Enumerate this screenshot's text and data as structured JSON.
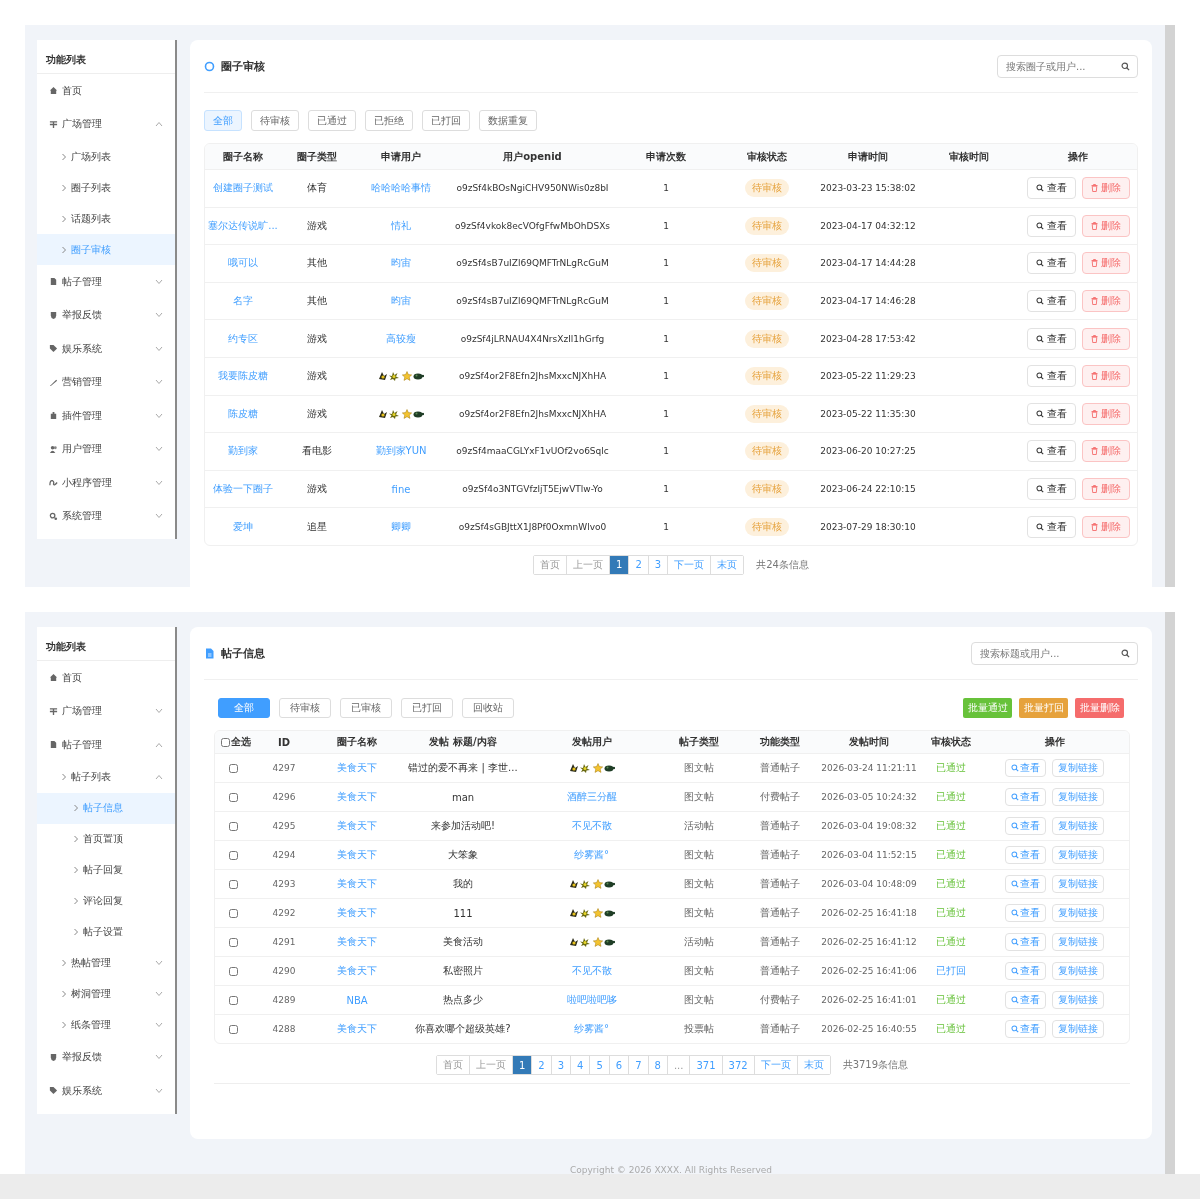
{
  "review_screen": {
    "sidebar": {
      "title": "功能列表",
      "items": [
        {
          "label": "首页",
          "selected": false
        },
        {
          "label": "广场管理",
          "selected": false,
          "expanded": true,
          "children": [
            {
              "label": "广场列表",
              "selected": false
            },
            {
              "label": "圈子列表",
              "selected": false
            },
            {
              "label": "话题列表",
              "selected": false
            },
            {
              "label": "圈子审核",
              "selected": true
            }
          ]
        },
        {
          "label": "帖子管理",
          "selected": false,
          "expanded": false
        },
        {
          "label": "举报反馈",
          "selected": false,
          "expanded": false
        },
        {
          "label": "娱乐系统",
          "selected": false,
          "expanded": false
        },
        {
          "label": "营销管理",
          "selected": false,
          "expanded": false
        },
        {
          "label": "插件管理",
          "selected": false,
          "expanded": false
        },
        {
          "label": "用户管理",
          "selected": false,
          "expanded": false
        },
        {
          "label": "小程序管理",
          "selected": false,
          "expanded": false
        },
        {
          "label": "系统管理",
          "selected": false,
          "expanded": false
        }
      ]
    },
    "title": "圈子审核",
    "search": {
      "placeholder": "搜索圈子或用户..."
    },
    "tabs": [
      {
        "label": "全部",
        "selected": true
      },
      {
        "label": "待审核",
        "selected": false
      },
      {
        "label": "已通过",
        "selected": false
      },
      {
        "label": "已拒绝",
        "selected": false
      },
      {
        "label": "已打回",
        "selected": false
      },
      {
        "label": "数据重复",
        "selected": false
      }
    ],
    "table": {
      "columns": [
        "圈子名称",
        "圈子类型",
        "申请用户",
        "用户openid",
        "申请次数",
        "审核状态",
        "申请时间",
        "审核时间",
        "操作"
      ],
      "rows": [
        {
          "name": "创建圈子测试",
          "type": "体育",
          "user": {
            "kind": "text",
            "text": "哈哈哈哈事情"
          },
          "openid": "o9zSf4kBOsNgiCHV950NWis0z8bI",
          "count": "1",
          "status": {
            "kind": "pending",
            "label": "待审核"
          },
          "applied_at": "2023-03-23 15:38:02",
          "actions": [
            {
              "kind": "view",
              "label": "查看"
            },
            {
              "kind": "delete",
              "label": "删除"
            }
          ]
        },
        {
          "name": "塞尔达传说旷...",
          "type": "游戏",
          "user": {
            "kind": "text",
            "text": "情礼"
          },
          "openid": "o9zSf4vkok8ecVOfgFfwMbOhDSXs",
          "count": "1",
          "status": {
            "kind": "pending",
            "label": "待审核"
          },
          "applied_at": "2023-04-17 04:32:12",
          "actions": [
            {
              "kind": "view",
              "label": "查看"
            },
            {
              "kind": "delete",
              "label": "删除"
            }
          ]
        },
        {
          "name": "哦可以",
          "type": "其他",
          "user": {
            "kind": "text",
            "text": "昀宙"
          },
          "openid": "o9zSf4sB7uIZl69QMFTrNLgRcGuM",
          "count": "1",
          "status": {
            "kind": "pending",
            "label": "待审核"
          },
          "applied_at": "2023-04-17 14:44:28",
          "actions": [
            {
              "kind": "view",
              "label": "查看"
            },
            {
              "kind": "delete",
              "label": "删除"
            }
          ]
        },
        {
          "name": "名字",
          "type": "其他",
          "user": {
            "kind": "text",
            "text": "昀宙"
          },
          "openid": "o9zSf4sB7uIZl69QMFTrNLgRcGuM",
          "count": "1",
          "status": {
            "kind": "pending",
            "label": "待审核"
          },
          "applied_at": "2023-04-17 14:46:28",
          "actions": [
            {
              "kind": "view",
              "label": "查看"
            },
            {
              "kind": "delete",
              "label": "删除"
            }
          ]
        },
        {
          "name": "约专区",
          "type": "游戏",
          "user": {
            "kind": "text",
            "text": "高较瘦"
          },
          "openid": "o9zSf4jLRNAU4X4NrsXzIl1hGrfg",
          "count": "1",
          "status": {
            "kind": "pending",
            "label": "待审核"
          },
          "applied_at": "2023-04-28 17:53:42",
          "actions": [
            {
              "kind": "view",
              "label": "查看"
            },
            {
              "kind": "delete",
              "label": "删除"
            }
          ]
        },
        {
          "name": "我要陈皮糖",
          "type": "游戏",
          "user": {
            "kind": "emoji"
          },
          "openid": "o9zSf4or2F8Efn2JhsMxxcNJXhHA",
          "count": "1",
          "status": {
            "kind": "pending",
            "label": "待审核"
          },
          "applied_at": "2023-05-22 11:29:23",
          "actions": [
            {
              "kind": "view",
              "label": "查看"
            },
            {
              "kind": "delete",
              "label": "删除"
            }
          ]
        },
        {
          "name": "陈皮糖",
          "type": "游戏",
          "user": {
            "kind": "emoji"
          },
          "openid": "o9zSf4or2F8Efn2JhsMxxcNJXhHA",
          "count": "1",
          "status": {
            "kind": "pending",
            "label": "待审核"
          },
          "applied_at": "2023-05-22 11:35:30",
          "actions": [
            {
              "kind": "view",
              "label": "查看"
            },
            {
              "kind": "delete",
              "label": "删除"
            }
          ]
        },
        {
          "name": "勤到家",
          "type": "看电影",
          "user": {
            "kind": "text",
            "text": "勤到家YUN"
          },
          "openid": "o9zSf4maaCGLYxF1vUOf2vo6Sqlc",
          "count": "1",
          "status": {
            "kind": "pending",
            "label": "待审核"
          },
          "applied_at": "2023-06-20 10:27:25",
          "actions": [
            {
              "kind": "view",
              "label": "查看"
            },
            {
              "kind": "delete",
              "label": "删除"
            }
          ]
        },
        {
          "name": "体验一下圈子",
          "type": "游戏",
          "user": {
            "kind": "text",
            "text": "fine"
          },
          "openid": "o9zSf4o3NTGVfzljT5EjwVTlw-Yo",
          "count": "1",
          "status": {
            "kind": "pending",
            "label": "待审核"
          },
          "applied_at": "2023-06-24 22:10:15",
          "actions": [
            {
              "kind": "view",
              "label": "查看"
            },
            {
              "kind": "delete",
              "label": "删除"
            }
          ]
        },
        {
          "name": "爱坤",
          "type": "追星",
          "user": {
            "kind": "text",
            "text": "卿卿"
          },
          "openid": "o9zSf4sGBJttX1J8Pf0OxmnWlvo0",
          "count": "1",
          "status": {
            "kind": "pending",
            "label": "待审核"
          },
          "applied_at": "2023-07-29 18:30:10",
          "actions": [
            {
              "kind": "view",
              "label": "查看"
            },
            {
              "kind": "delete",
              "label": "删除"
            }
          ]
        }
      ]
    },
    "pagination": {
      "pages": [
        {
          "label": "首页",
          "selected": false,
          "disabled": true
        },
        {
          "label": "上一页",
          "selected": false,
          "disabled": true
        },
        {
          "label": "1",
          "selected": true,
          "disabled": false
        },
        {
          "label": "2",
          "selected": false,
          "disabled": false
        },
        {
          "label": "3",
          "selected": false,
          "disabled": false
        },
        {
          "label": "下一页",
          "selected": false,
          "disabled": false
        },
        {
          "label": "末页",
          "selected": false,
          "disabled": false
        }
      ],
      "summary": "共24条信息"
    }
  },
  "posts_screen": {
    "sidebar": {
      "title": "功能列表",
      "items": [
        {
          "label": "首页",
          "selected": false
        },
        {
          "label": "广场管理",
          "selected": false,
          "expanded": false
        },
        {
          "label": "帖子管理",
          "selected": false,
          "expanded": true,
          "children": [
            {
              "label": "帖子列表",
              "selected": false,
              "expanded": true,
              "children": [
                {
                  "label": "帖子信息",
                  "selected": true
                },
                {
                  "label": "首页置顶",
                  "selected": false
                },
                {
                  "label": "帖子回复",
                  "selected": false
                },
                {
                  "label": "评论回复",
                  "selected": false
                },
                {
                  "label": "帖子设置",
                  "selected": false
                }
              ]
            },
            {
              "label": "热帖管理",
              "selected": false,
              "expanded": false
            },
            {
              "label": "树洞管理",
              "selected": false,
              "expanded": false
            },
            {
              "label": "纸条管理",
              "selected": false,
              "expanded": false
            }
          ]
        },
        {
          "label": "举报反馈",
          "selected": false,
          "expanded": false
        },
        {
          "label": "娱乐系统",
          "selected": false,
          "expanded": false
        }
      ]
    },
    "title": "帖子信息",
    "search": {
      "placeholder": "搜索标题或用户..."
    },
    "tabs": [
      {
        "label": "全部",
        "selected": true
      },
      {
        "label": "待审核",
        "selected": false
      },
      {
        "label": "已审核",
        "selected": false
      },
      {
        "label": "已打回",
        "selected": false
      },
      {
        "label": "回收站",
        "selected": false
      }
    ],
    "batch_buttons": [
      {
        "kind": "approve",
        "label": "批量通过"
      },
      {
        "kind": "return",
        "label": "批量打回"
      },
      {
        "kind": "delete",
        "label": "批量删除"
      }
    ],
    "table": {
      "select_all": {
        "label": "全选",
        "checked": false
      },
      "columns": [
        "ID",
        "圈子名称",
        "发帖 标题/内容",
        "发帖用户",
        "帖子类型",
        "功能类型",
        "发帖时间",
        "审核状态",
        "操作"
      ],
      "rows": [
        {
          "checked": false,
          "id": "4297",
          "circle": "美食天下",
          "title": "错过的爱不再来 | 李世...",
          "user": {
            "kind": "emoji"
          },
          "post_type": "图文帖",
          "feature_type": "普通帖子",
          "posted_at": "2026-03-24 11:21:11",
          "status": {
            "kind": "approved",
            "label": "已通过"
          },
          "actions": [
            {
              "kind": "view",
              "label": "查看"
            },
            {
              "kind": "copy",
              "label": "复制链接"
            }
          ]
        },
        {
          "checked": false,
          "id": "4296",
          "circle": "美食天下",
          "title": "man",
          "user": {
            "kind": "text",
            "text": "酒醉三分醒"
          },
          "post_type": "图文帖",
          "feature_type": "付费帖子",
          "posted_at": "2026-03-05 10:24:32",
          "status": {
            "kind": "approved",
            "label": "已通过"
          },
          "actions": [
            {
              "kind": "view",
              "label": "查看"
            },
            {
              "kind": "copy",
              "label": "复制链接"
            }
          ]
        },
        {
          "checked": false,
          "id": "4295",
          "circle": "美食天下",
          "title": "来参加活动吧!",
          "user": {
            "kind": "text",
            "text": "不见不散"
          },
          "post_type": "活动帖",
          "feature_type": "普通帖子",
          "posted_at": "2026-03-04 19:08:32",
          "status": {
            "kind": "approved",
            "label": "已通过"
          },
          "actions": [
            {
              "kind": "view",
              "label": "查看"
            },
            {
              "kind": "copy",
              "label": "复制链接"
            }
          ]
        },
        {
          "checked": false,
          "id": "4294",
          "circle": "美食天下",
          "title": "大笨象",
          "user": {
            "kind": "text",
            "text": "纱雾酱°"
          },
          "post_type": "图文帖",
          "feature_type": "普通帖子",
          "posted_at": "2026-03-04 11:52:15",
          "status": {
            "kind": "approved",
            "label": "已通过"
          },
          "actions": [
            {
              "kind": "view",
              "label": "查看"
            },
            {
              "kind": "copy",
              "label": "复制链接"
            }
          ]
        },
        {
          "checked": false,
          "id": "4293",
          "circle": "美食天下",
          "title": "我的",
          "user": {
            "kind": "emoji"
          },
          "post_type": "图文帖",
          "feature_type": "普通帖子",
          "posted_at": "2026-03-04 10:48:09",
          "status": {
            "kind": "approved",
            "label": "已通过"
          },
          "actions": [
            {
              "kind": "view",
              "label": "查看"
            },
            {
              "kind": "copy",
              "label": "复制链接"
            }
          ]
        },
        {
          "checked": false,
          "id": "4292",
          "circle": "美食天下",
          "title": "111",
          "user": {
            "kind": "emoji"
          },
          "post_type": "图文帖",
          "feature_type": "普通帖子",
          "posted_at": "2026-02-25 16:41:18",
          "status": {
            "kind": "approved",
            "label": "已通过"
          },
          "actions": [
            {
              "kind": "view",
              "label": "查看"
            },
            {
              "kind": "copy",
              "label": "复制链接"
            }
          ]
        },
        {
          "checked": false,
          "id": "4291",
          "circle": "美食天下",
          "title": "美食活动",
          "user": {
            "kind": "emoji"
          },
          "post_type": "活动帖",
          "feature_type": "普通帖子",
          "posted_at": "2026-02-25 16:41:12",
          "status": {
            "kind": "approved",
            "label": "已通过"
          },
          "actions": [
            {
              "kind": "view",
              "label": "查看"
            },
            {
              "kind": "copy",
              "label": "复制链接"
            }
          ]
        },
        {
          "checked": false,
          "id": "4290",
          "circle": "美食天下",
          "title": "私密照片",
          "user": {
            "kind": "text",
            "text": "不见不散"
          },
          "post_type": "图文帖",
          "feature_type": "普通帖子",
          "posted_at": "2026-02-25 16:41:06",
          "status": {
            "kind": "returned",
            "label": "已打回"
          },
          "actions": [
            {
              "kind": "view",
              "label": "查看"
            },
            {
              "kind": "copy",
              "label": "复制链接"
            }
          ]
        },
        {
          "checked": false,
          "id": "4289",
          "circle": "NBA",
          "title": "热点多少",
          "user": {
            "kind": "text",
            "text": "啦吧啦吧哆"
          },
          "post_type": "图文帖",
          "feature_type": "付费帖子",
          "posted_at": "2026-02-25 16:41:01",
          "status": {
            "kind": "approved",
            "label": "已通过"
          },
          "actions": [
            {
              "kind": "view",
              "label": "查看"
            },
            {
              "kind": "copy",
              "label": "复制链接"
            }
          ]
        },
        {
          "checked": false,
          "id": "4288",
          "circle": "美食天下",
          "title": "你喜欢哪个超级英雄?",
          "user": {
            "kind": "text",
            "text": "纱雾酱°"
          },
          "post_type": "投票帖",
          "feature_type": "普通帖子",
          "posted_at": "2026-02-25 16:40:55",
          "status": {
            "kind": "approved",
            "label": "已通过"
          },
          "actions": [
            {
              "kind": "view",
              "label": "查看"
            },
            {
              "kind": "copy",
              "label": "复制链接"
            }
          ]
        }
      ]
    },
    "pagination": {
      "pages": [
        {
          "label": "首页",
          "selected": false,
          "disabled": true
        },
        {
          "label": "上一页",
          "selected": false,
          "disabled": true
        },
        {
          "label": "1",
          "selected": true,
          "disabled": false
        },
        {
          "label": "2",
          "selected": false,
          "disabled": false
        },
        {
          "label": "3",
          "selected": false,
          "disabled": false
        },
        {
          "label": "4",
          "selected": false,
          "disabled": false
        },
        {
          "label": "5",
          "selected": false,
          "disabled": false
        },
        {
          "label": "6",
          "selected": false,
          "disabled": false
        },
        {
          "label": "7",
          "selected": false,
          "disabled": false
        },
        {
          "label": "8",
          "selected": false,
          "disabled": false
        },
        {
          "label": "...",
          "selected": false,
          "disabled": true
        },
        {
          "label": "371",
          "selected": false,
          "disabled": false
        },
        {
          "label": "372",
          "selected": false,
          "disabled": false
        },
        {
          "label": "下一页",
          "selected": false,
          "disabled": false
        },
        {
          "label": "末页",
          "selected": false,
          "disabled": false
        }
      ],
      "summary": "共3719条信息"
    },
    "footer": "Copyright © 2026 XXXX. All Rights Reserved"
  }
}
